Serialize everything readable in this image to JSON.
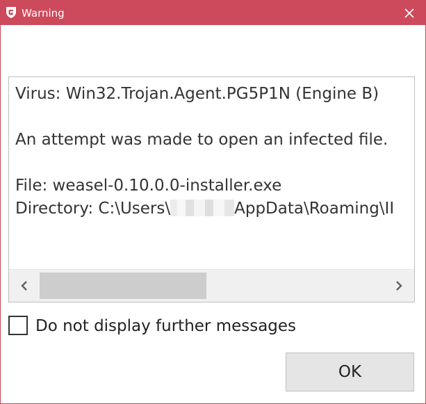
{
  "window": {
    "title": "Warning",
    "accent_color": "#cc4a5b",
    "logo_icon": "g-shield-logo",
    "close_icon": "close-x"
  },
  "message": {
    "virus_line": "Virus: Win32.Trojan.Agent.PG5P1N (Engine B)",
    "attempt_line": "An attempt was made to open an infected file.",
    "file_line": "File: weasel-0.10.0.0-installer.exe",
    "directory_prefix": "Directory: C:\\Users\\",
    "directory_suffix": "AppData\\Roaming\\II"
  },
  "scrollbar": {
    "left_icon": "chevron-left",
    "right_icon": "chevron-right"
  },
  "checkbox": {
    "label": "Do not display further messages",
    "checked": false
  },
  "buttons": {
    "ok_label": "OK"
  }
}
